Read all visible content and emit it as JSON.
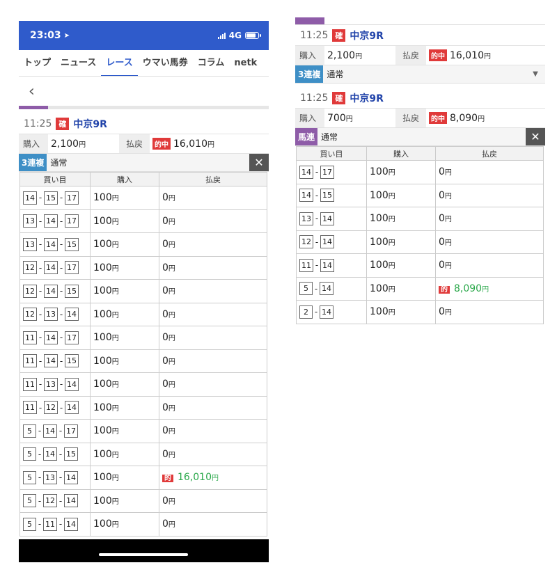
{
  "status": {
    "time": "23:03",
    "network": "4G"
  },
  "nav": {
    "tabs": [
      "トップ",
      "ニュース",
      "レース",
      "ウマい馬券",
      "コラム",
      "netk"
    ]
  },
  "nav_back": "‹",
  "colors": {
    "accent": "#2f5bcb",
    "sanrenpuku": "#3e8fc6",
    "umaren": "#8e5ca8",
    "hit": "#e03a3a",
    "hit_amount": "#2aa84a"
  },
  "left": {
    "race": {
      "time": "11:25",
      "badge": "確",
      "name": "中京9R"
    },
    "summary": {
      "buy_label": "購入",
      "buy_value": "2,100",
      "buy_unit": "円",
      "payout_label": "払戻",
      "hit_badge": "的中",
      "payout_value": "16,010",
      "payout_unit": "円"
    },
    "bet_type": {
      "type": "3連複",
      "mode": "通常",
      "close": "✕"
    },
    "table": {
      "headers": [
        "買い目",
        "購入",
        "払戻"
      ],
      "rows": [
        {
          "a": "14",
          "b": "15",
          "c": "17",
          "buy": "100",
          "pay": "0",
          "hit": false
        },
        {
          "a": "13",
          "b": "14",
          "c": "17",
          "buy": "100",
          "pay": "0",
          "hit": false
        },
        {
          "a": "13",
          "b": "14",
          "c": "15",
          "buy": "100",
          "pay": "0",
          "hit": false
        },
        {
          "a": "12",
          "b": "14",
          "c": "17",
          "buy": "100",
          "pay": "0",
          "hit": false
        },
        {
          "a": "12",
          "b": "14",
          "c": "15",
          "buy": "100",
          "pay": "0",
          "hit": false
        },
        {
          "a": "12",
          "b": "13",
          "c": "14",
          "buy": "100",
          "pay": "0",
          "hit": false
        },
        {
          "a": "11",
          "b": "14",
          "c": "17",
          "buy": "100",
          "pay": "0",
          "hit": false
        },
        {
          "a": "11",
          "b": "14",
          "c": "15",
          "buy": "100",
          "pay": "0",
          "hit": false
        },
        {
          "a": "11",
          "b": "13",
          "c": "14",
          "buy": "100",
          "pay": "0",
          "hit": false
        },
        {
          "a": "11",
          "b": "12",
          "c": "14",
          "buy": "100",
          "pay": "0",
          "hit": false
        },
        {
          "a": "5",
          "b": "14",
          "c": "17",
          "buy": "100",
          "pay": "0",
          "hit": false
        },
        {
          "a": "5",
          "b": "14",
          "c": "15",
          "buy": "100",
          "pay": "0",
          "hit": false
        },
        {
          "a": "5",
          "b": "13",
          "c": "14",
          "buy": "100",
          "pay": "16,010",
          "hit": true
        },
        {
          "a": "5",
          "b": "12",
          "c": "14",
          "buy": "100",
          "pay": "0",
          "hit": false
        },
        {
          "a": "5",
          "b": "11",
          "c": "14",
          "buy": "100",
          "pay": "0",
          "hit": false
        }
      ]
    }
  },
  "right": {
    "first": {
      "race": {
        "time": "11:25",
        "badge": "確",
        "name": "中京9R"
      },
      "summary": {
        "buy_label": "購入",
        "buy_value": "2,100",
        "buy_unit": "円",
        "payout_label": "払戻",
        "hit_badge": "的中",
        "payout_value": "16,010",
        "payout_unit": "円"
      },
      "bet_type": {
        "type": "3連複",
        "mode": "通常",
        "dropdown": "▼"
      }
    },
    "second": {
      "race": {
        "time": "11:25",
        "badge": "確",
        "name": "中京9R"
      },
      "summary": {
        "buy_label": "購入",
        "buy_value": "700",
        "buy_unit": "円",
        "payout_label": "払戻",
        "hit_badge": "的中",
        "payout_value": "8,090",
        "payout_unit": "円"
      },
      "bet_type": {
        "type": "馬連",
        "mode": "通常",
        "close": "✕"
      },
      "table": {
        "headers": [
          "買い目",
          "購入",
          "払戻"
        ],
        "rows": [
          {
            "a": "14",
            "b": "17",
            "buy": "100",
            "pay": "0",
            "hit": false
          },
          {
            "a": "14",
            "b": "15",
            "buy": "100",
            "pay": "0",
            "hit": false
          },
          {
            "a": "13",
            "b": "14",
            "buy": "100",
            "pay": "0",
            "hit": false
          },
          {
            "a": "12",
            "b": "14",
            "buy": "100",
            "pay": "0",
            "hit": false
          },
          {
            "a": "11",
            "b": "14",
            "buy": "100",
            "pay": "0",
            "hit": false
          },
          {
            "a": "5",
            "b": "14",
            "buy": "100",
            "pay": "8,090",
            "hit": true
          },
          {
            "a": "2",
            "b": "14",
            "buy": "100",
            "pay": "0",
            "hit": false
          }
        ]
      }
    },
    "units": {
      "yen": "円",
      "hit_mini": "的"
    }
  }
}
